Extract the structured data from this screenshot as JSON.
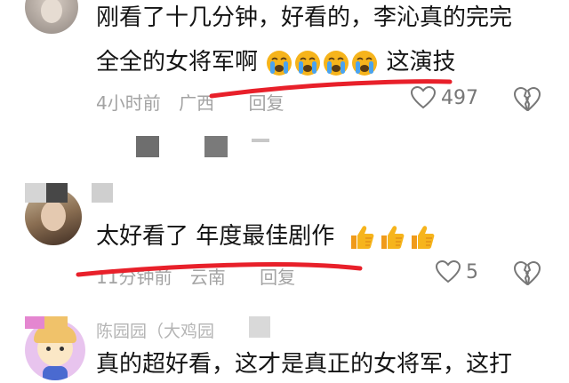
{
  "comments": [
    {
      "text_line1": "刚看了十几分钟，好看的，李沁真的完完",
      "text_line2_prefix": "全全的女将军啊",
      "text_line2_suffix": "这演技",
      "time": "4小时前",
      "location": "广西",
      "reply": "回复",
      "likes": "497"
    },
    {
      "text": "太好看了 年度最佳剧作",
      "time": "11分钟前",
      "location": "云南",
      "reply": "回复",
      "likes": "5"
    },
    {
      "username": "陈园园（大鸡园",
      "text": "真的超好看，这才是真正的女将军，这打"
    }
  ],
  "icons": {
    "like": "heart-outline-icon",
    "dislike": "broken-heart-icon",
    "cry": "loudly-crying-face-emoji",
    "thumbs": "thumbs-up-emoji"
  },
  "colors": {
    "underline": "#e8202a",
    "meta_text": "#a3a3a3",
    "emoji_yellow": "#f6b41c"
  }
}
